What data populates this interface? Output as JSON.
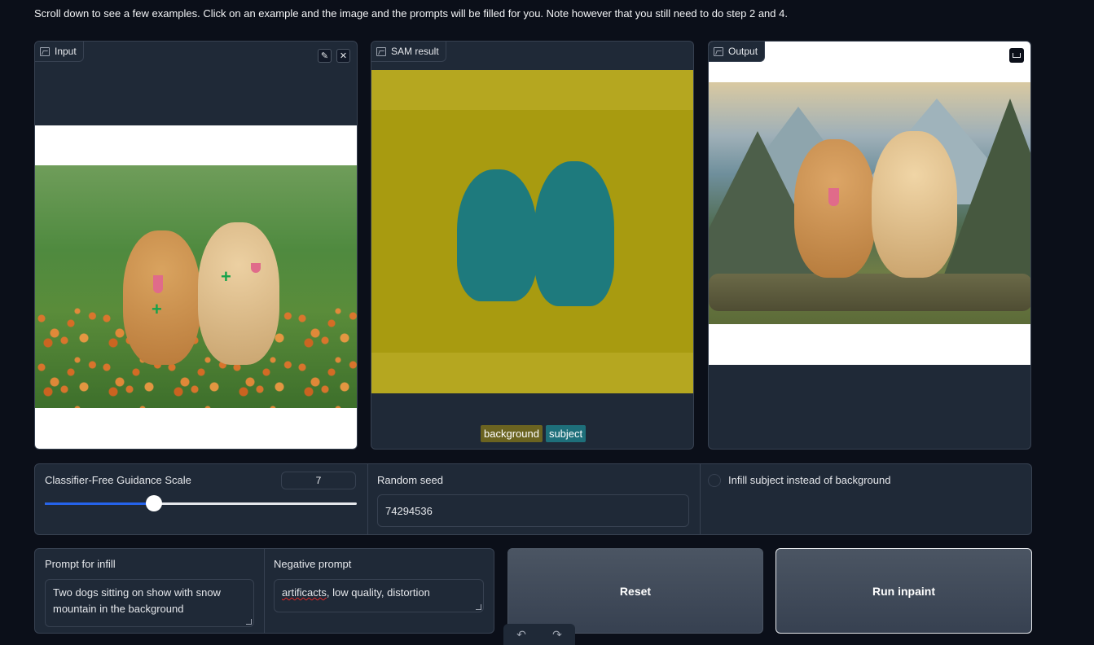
{
  "intro_text": "Scroll down to see a few examples. Click on an example and the image and the prompts will be filled for you. Note however that you still need to do step 2 and 4.",
  "panels": {
    "input": {
      "label": "Input",
      "icon": "image-icon"
    },
    "sam": {
      "label": "SAM result",
      "icon": "image-icon"
    },
    "output": {
      "label": "Output",
      "icon": "image-icon"
    }
  },
  "sam_legend": [
    {
      "label": "background",
      "color": "#6b6320"
    },
    {
      "label": "subject",
      "color": "#1e6f7a"
    }
  ],
  "guidance": {
    "label": "Classifier-Free Guidance Scale",
    "value": "7",
    "fraction": 0.35
  },
  "seed": {
    "label": "Random seed",
    "value": "74294536"
  },
  "infill_toggle": {
    "label": "Infill subject instead of background",
    "checked": false
  },
  "prompt": {
    "label": "Prompt for infill",
    "value": "Two dogs sitting on show with snow mountain in the background"
  },
  "negative": {
    "label": "Negative prompt",
    "value_misspelled": "artificacts",
    "value_rest": ", low quality, distortion"
  },
  "buttons": {
    "reset": "Reset",
    "run": "Run inpaint"
  },
  "colors": {
    "accent": "#2563eb",
    "panel": "#1f2937",
    "background": "#0b0f19"
  }
}
